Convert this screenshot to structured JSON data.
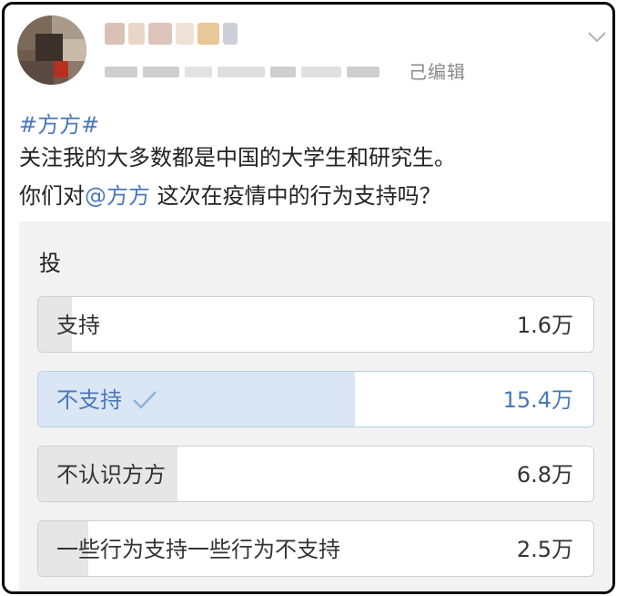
{
  "post": {
    "edited_label": "己编辑",
    "hashtag": "#方方#",
    "line1": "关注我的大多数都是中国的大学生和研究生。",
    "line2_prefix": "你们对",
    "line2_mention": "@方方",
    "line2_suffix": " 这次在疫情中的行为支持吗？"
  },
  "poll": {
    "title": "投",
    "options": [
      {
        "label": "支持",
        "count": "1.6万",
        "fraction": 0.06,
        "selected": false
      },
      {
        "label": "不支持",
        "count": "15.4万",
        "fraction": 0.57,
        "selected": true
      },
      {
        "label": "不认识方方",
        "count": "6.8万",
        "fraction": 0.25,
        "selected": false
      },
      {
        "label": "一些行为支持一些行为不支持",
        "count": "2.5万",
        "fraction": 0.09,
        "selected": false
      }
    ]
  },
  "colors": {
    "link": "#4a78b8",
    "selected_fill": "#dae6f4",
    "option_fill": "#e6e6e6"
  },
  "icons": {
    "selected_check": "checkmark-icon",
    "menu": "chevron-down-icon"
  }
}
